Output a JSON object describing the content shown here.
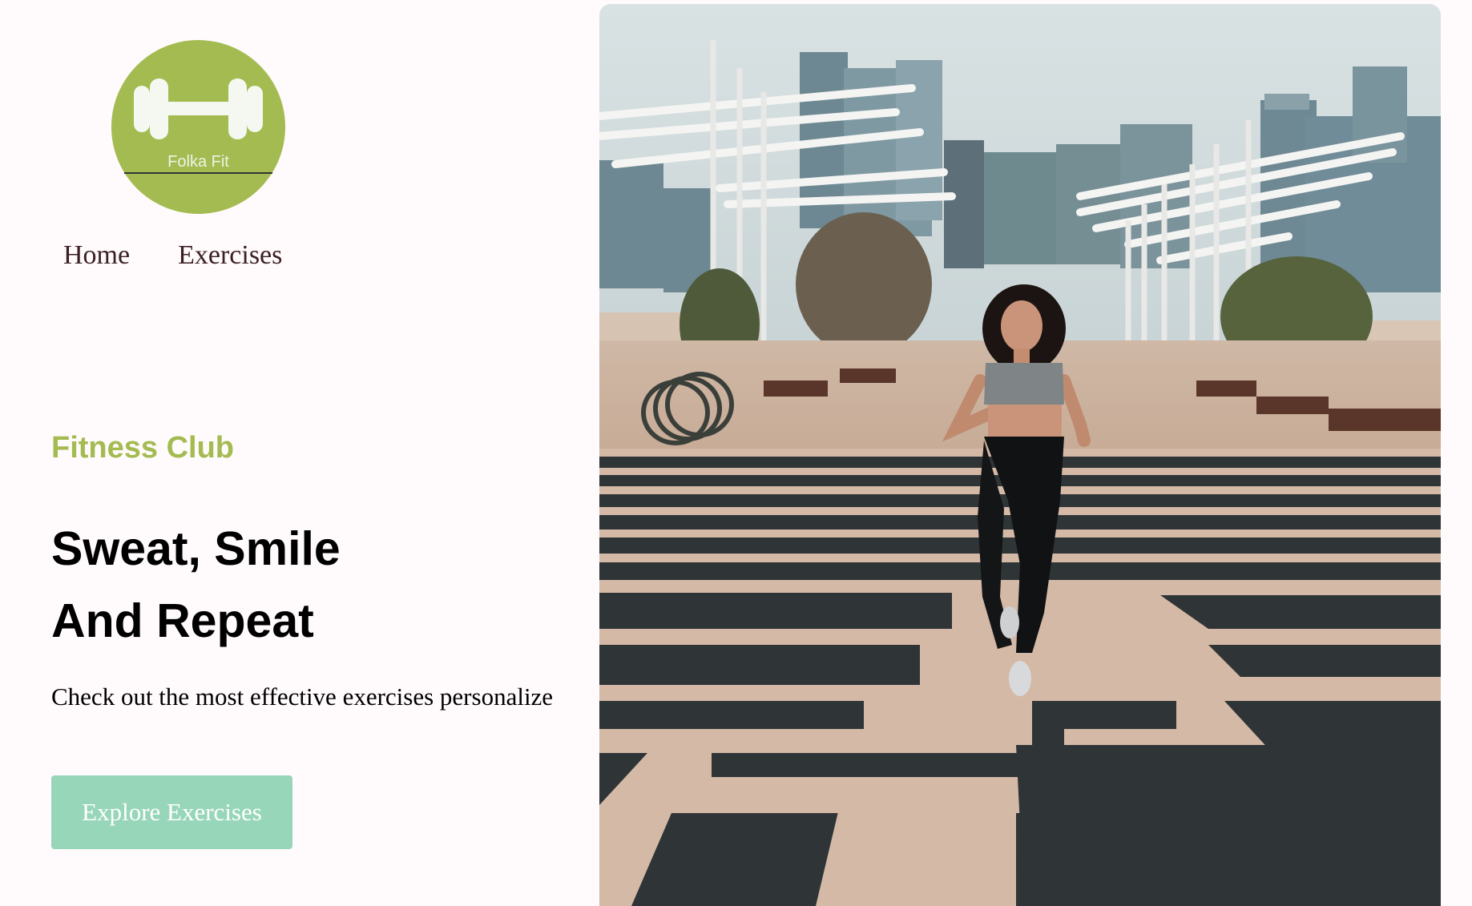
{
  "logo": {
    "brand_text": "Folka Fit",
    "icon": "dumbbell-icon",
    "color": "#a3bb50"
  },
  "nav": {
    "items": [
      {
        "label": "Home"
      },
      {
        "label": "Exercises"
      }
    ]
  },
  "hero": {
    "eyebrow": "Fitness Club",
    "headline_line1": "Sweat, Smile",
    "headline_line2": "And Repeat",
    "subtext": "Check out the most effective exercises personalize",
    "cta_label": "Explore Exercises",
    "image_subject": "woman-running-on-striped-plaza"
  },
  "colors": {
    "accent": "#a3bb50",
    "button": "#98d6b9",
    "background": "#fffafb",
    "nav_text": "#3a1f23"
  }
}
